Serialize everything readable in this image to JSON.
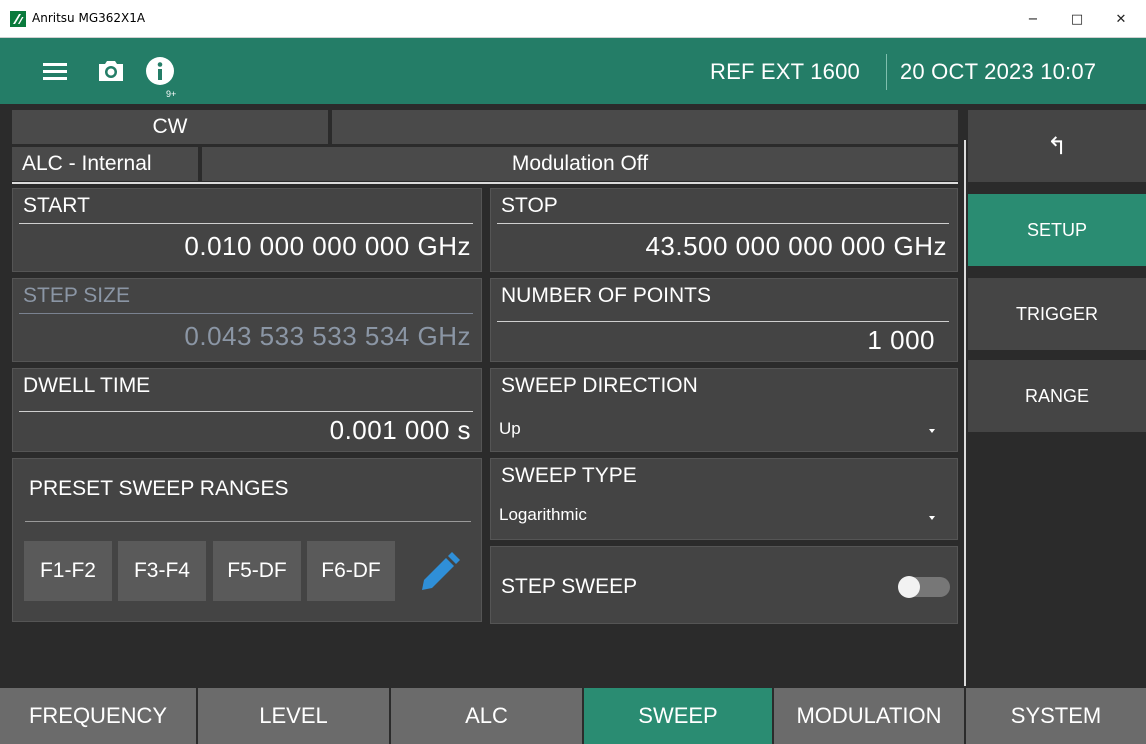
{
  "window": {
    "title": "Anritsu MG362X1A",
    "minimize": "−",
    "maximize": "□",
    "close": "✕"
  },
  "header": {
    "icons": [
      "menu-icon",
      "camera-icon",
      "info-icon"
    ],
    "badge": "9+",
    "reference": "REF EXT 1600",
    "datetime": "20 OCT 2023 10:07",
    "color": "#247d67"
  },
  "status": {
    "mode": "CW",
    "alc": "ALC - Internal",
    "modulation": "Modulation Off",
    "mode_detail": ""
  },
  "sweep": {
    "start": {
      "label": "START",
      "value": "0.010  000  000  000 GHz"
    },
    "stop": {
      "label": "STOP",
      "value": "43.500  000  000  000 GHz"
    },
    "step_size": {
      "label": "STEP SIZE",
      "value": "0.043  533  533  534 GHz"
    },
    "num_points": {
      "label": "NUMBER OF POINTS",
      "value": "1  000"
    },
    "dwell_time": {
      "label": "DWELL TIME",
      "value": "0.001  000 s"
    },
    "direction": {
      "label": "SWEEP DIRECTION",
      "value": "Up"
    },
    "type": {
      "label": "SWEEP TYPE",
      "value": "Logarithmic"
    },
    "step_sweep": {
      "label": "STEP SWEEP",
      "enabled": false
    },
    "presets": {
      "label": "PRESET SWEEP RANGES",
      "buttons": [
        "F1-F2",
        "F3-F4",
        "F5-DF",
        "F6-DF"
      ],
      "edit_icon": "pencil-icon"
    }
  },
  "side_menu": {
    "back_symbol": "↰",
    "items": [
      "SETUP",
      "TRIGGER",
      "RANGE"
    ],
    "active": "SETUP"
  },
  "tabs": {
    "items": [
      "FREQUENCY",
      "LEVEL",
      "ALC",
      "SWEEP",
      "MODULATION",
      "SYSTEM"
    ],
    "active": "SWEEP"
  },
  "colors": {
    "accent": "#2a8c72",
    "header": "#247d67",
    "panel": "#444444",
    "pencil": "#2f8fd8",
    "disabled_text": "#8b96a5"
  }
}
